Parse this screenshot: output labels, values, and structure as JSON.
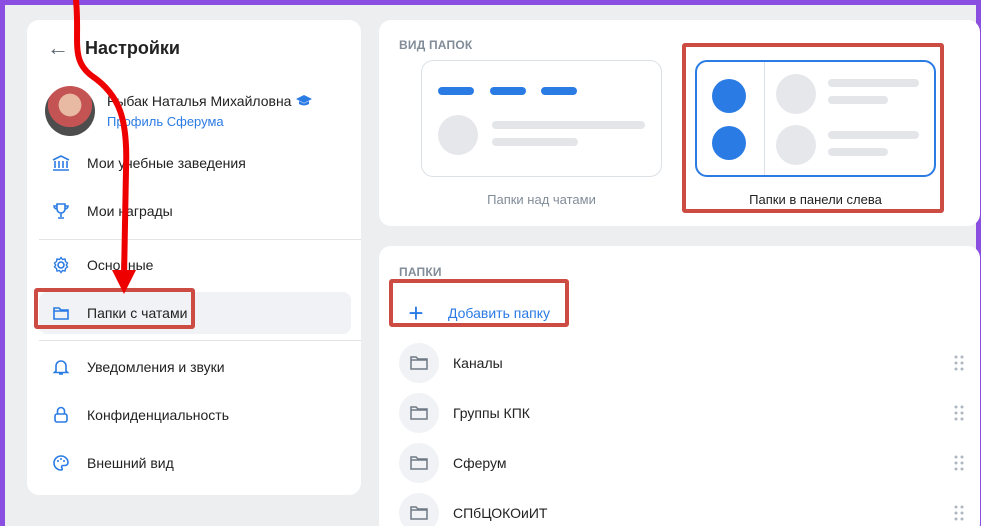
{
  "header": {
    "title": "Настройки"
  },
  "profile": {
    "name": "Рыбак Наталья Михайловна",
    "link": "Профиль Сферума"
  },
  "menu": [
    {
      "label": "Мои учебные заведения",
      "icon": "building-icon"
    },
    {
      "label": "Мои награды",
      "icon": "trophy-icon"
    },
    {
      "label": "Основные",
      "icon": "gear-icon"
    },
    {
      "label": "Папки с чатами",
      "icon": "folder-icon"
    },
    {
      "label": "Уведомления и звуки",
      "icon": "bell-icon"
    },
    {
      "label": "Конфиденциальность",
      "icon": "lock-icon"
    },
    {
      "label": "Внешний вид",
      "icon": "palette-icon"
    }
  ],
  "view": {
    "section_title": "ВИД ПАПОК",
    "option_top": "Папки над чатами",
    "option_left": "Папки в панели слева"
  },
  "folders": {
    "section_title": "ПАПКИ",
    "add_label": "Добавить папку",
    "items": [
      "Каналы",
      "Группы КПК",
      "Сферум",
      "СПбЦОКОиИТ"
    ]
  },
  "colors": {
    "accent": "#2a7be4",
    "highlight": "#cc4b42",
    "frame": "#8a4fe0",
    "arrow": "#ee0000"
  }
}
